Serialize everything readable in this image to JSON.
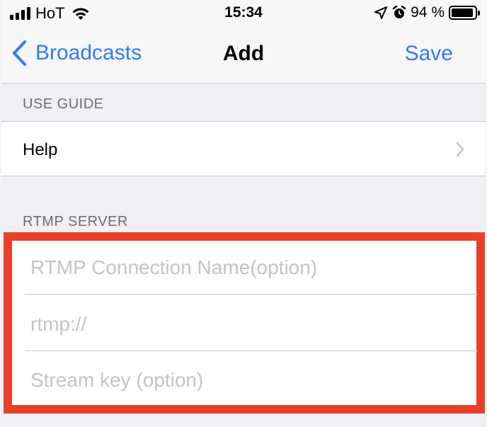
{
  "status_bar": {
    "carrier": "HoT",
    "time": "15:34",
    "battery_percent": "94 %",
    "battery_level": 0.94,
    "icons": [
      "signal-icon",
      "wifi-icon",
      "location-icon",
      "alarm-icon",
      "battery-icon"
    ]
  },
  "nav": {
    "back_label": "Broadcasts",
    "title": "Add",
    "save_label": "Save"
  },
  "sections": {
    "use_guide": {
      "header": "USE GUIDE",
      "help_label": "Help"
    },
    "rtmp_server": {
      "header": "RTMP SERVER",
      "connection_name_placeholder": "RTMP Connection Name(option)",
      "url_placeholder": "rtmp://",
      "stream_key_placeholder": "Stream key (option)"
    }
  },
  "colors": {
    "accent": "#2f7bf5",
    "highlight_border": "#e84028",
    "background": "#efeff4"
  }
}
